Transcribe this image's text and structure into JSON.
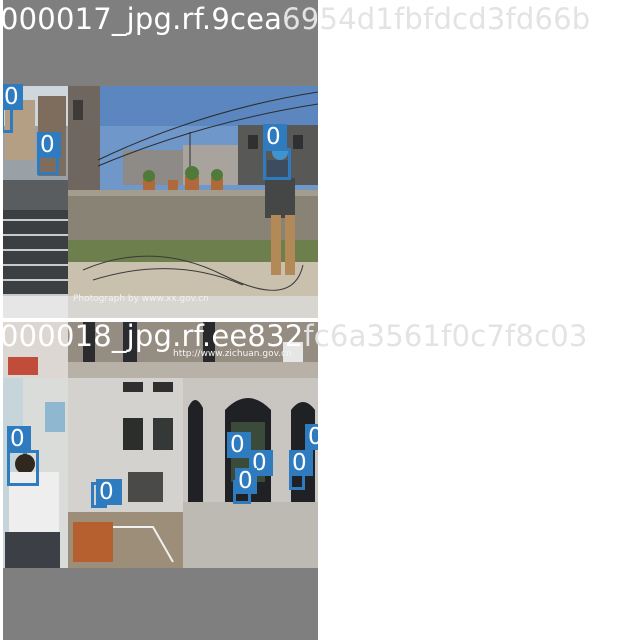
{
  "mosaics": [
    {
      "title_white": "000017_jpg.rf.9cea",
      "title_light": "6954d1fbfdcd3fd66b",
      "watermark": "Photograph by www.xx.gov.cn"
    },
    {
      "title_white": "000018_jpg.rf.ee832",
      "title_light": "fc6a3561f0c7f8c03",
      "watermark": "http://www.zichuan.gov.cn"
    }
  ],
  "detections": {
    "class_label": "0",
    "box_color": "#2f7bc0"
  }
}
